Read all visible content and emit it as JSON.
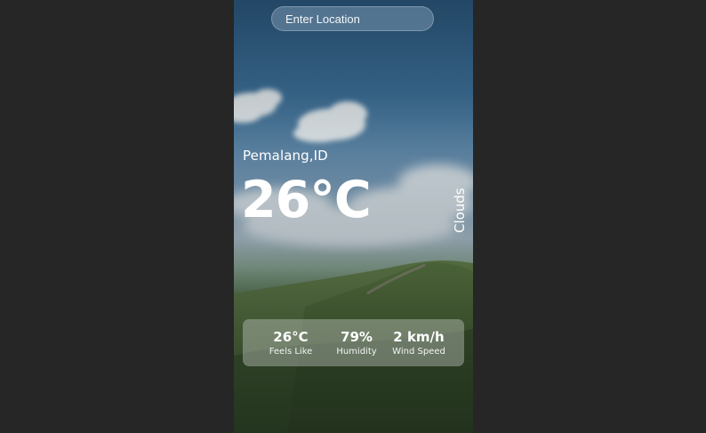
{
  "search": {
    "placeholder": "Enter Location"
  },
  "weather": {
    "location": "Pemalang,ID",
    "temperature": "26°C",
    "condition": "Clouds"
  },
  "details": [
    {
      "value": "26°C",
      "label": "Feels Like"
    },
    {
      "value": "79%",
      "label": "Humidity"
    },
    {
      "value": "2 km/h",
      "label": "Wind Speed"
    }
  ],
  "colors": {
    "page_background": "#262626",
    "text": "#ffffff"
  },
  "icons": []
}
